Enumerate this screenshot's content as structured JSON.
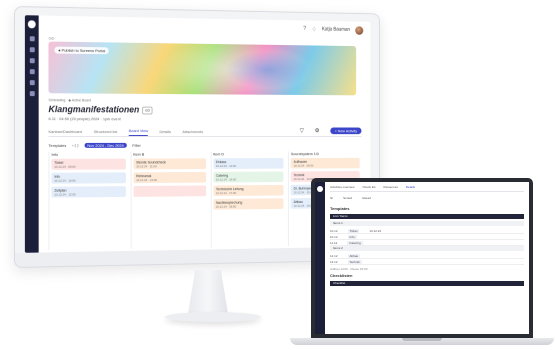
{
  "colors": {
    "accent": "#3b45c9",
    "sidebar": "#1c1f3a",
    "card_pink": "#fde3e1",
    "card_orange": "#fde9d6",
    "card_green": "#e4f5e8",
    "card_blue": "#e3eefa"
  },
  "desktop": {
    "topbar": {
      "user_name": "Katja Bauman"
    },
    "breadcrumb": "GD",
    "banner_chip": "● Publish to Screens Portal",
    "small_meta": "Scheduling · ◆ Active Board",
    "title": "Klangmanifestationen",
    "title_badge": "GD",
    "meta": "6.11 · 04:50 (20 people) 2024 · 1pm event",
    "tabs": [
      "Kanban/Dashboard",
      "Structured list",
      "Board View",
      "Details",
      "Attachments"
    ],
    "primary_button": "+ New Activity",
    "toolbar": {
      "view": "Templates",
      "nav": "‹ ⟨ ⟩",
      "range": "Nov 2024 - Dec 2024",
      "filter": "Filter"
    },
    "columns": [
      {
        "head": "Info",
        "cards": [
          {
            "title": "Ticket",
            "sub": "10.12.24 · 09:00",
            "color": "pink"
          },
          {
            "title": "Info",
            "sub": "10.12.24 · 10:00",
            "color": "blue"
          },
          {
            "title": "Zeitplan",
            "sub": "10.12.24 · 12:00",
            "color": "blue"
          }
        ]
      },
      {
        "head": "Item B",
        "cards": [
          {
            "title": "Stunde Soundcheck",
            "sub": "10.12.24 · 11:00",
            "color": "orange"
          },
          {
            "title": "Rehearsal",
            "sub": "10.12.24 · 13:00",
            "color": "orange"
          },
          {
            "title": "",
            "sub": "",
            "color": "pink"
          }
        ]
      },
      {
        "head": "Item D",
        "cards": [
          {
            "title": "Einlass",
            "sub": "10.12.24 · 14:00",
            "color": "blue"
          },
          {
            "title": "Catering",
            "sub": "10.12.24 · 16:00",
            "color": "green"
          },
          {
            "title": "Technische Leitung",
            "sub": "10.12.24 · 17:00",
            "color": "orange"
          },
          {
            "title": "Nachbesprechung",
            "sub": "10.12.24 · 18:00",
            "color": "orange"
          }
        ]
      },
      {
        "head": "Soundsystem 1/3",
        "cards": [
          {
            "title": "Aufbauen",
            "sub": "10.12.24 · 09:30",
            "color": "orange"
          },
          {
            "title": "Technik",
            "sub": "10.12.24 · 12:00",
            "color": "pink"
          },
          {
            "title": "Dr. Buhmann",
            "sub": "10.12.24 · 15:00",
            "color": "blue"
          },
          {
            "title": "Abbau",
            "sub": "10.12.24 · 19:00",
            "color": "blue"
          }
        ]
      }
    ]
  },
  "laptop": {
    "tabs": [
      "Activities overview",
      "Check list",
      "Resources",
      "Details"
    ],
    "filters": [
      "Nr",
      "Sorted",
      "Ahead"
    ],
    "section1": "Templates",
    "bars": [
      "List / Items",
      "Items 1"
    ],
    "rows": [
      {
        "a": "10.12",
        "b": "Ticket",
        "c": "10.12.24"
      },
      {
        "a": "10.12",
        "b": "Info",
        "c": ""
      },
      {
        "a": "11.12",
        "b": "Catering",
        "c": ""
      }
    ],
    "bar2": "Items 2",
    "rows2": [
      {
        "a": "12.12",
        "b": "Abbau",
        "c": ""
      },
      {
        "a": "13.12",
        "b": "Technik",
        "c": ""
      }
    ],
    "hint": "Aufbau 14:00 · Pause 15:00",
    "section2": "Checklisten",
    "bar3": "Checklist"
  }
}
